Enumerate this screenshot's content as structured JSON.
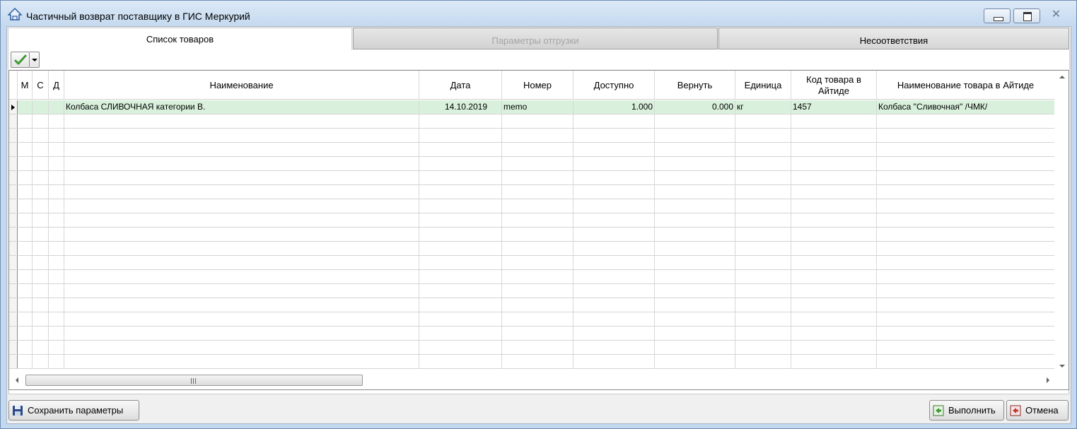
{
  "window": {
    "title": "Частичный возврат поставщику в ГИС Меркурий",
    "min_icon": "minimize-icon",
    "max_icon": "restore-icon",
    "close_symbol": "✕"
  },
  "tabs": [
    {
      "label": "Список товаров",
      "state": "active"
    },
    {
      "label": "Параметры отгрузки",
      "state": "disabled"
    },
    {
      "label": "Несоответствия",
      "state": "normal"
    }
  ],
  "toolbar": {
    "check_icon": "checkmark-icon",
    "dropdown_icon": "chevron-down-icon"
  },
  "grid": {
    "columns": [
      "М",
      "С",
      "Д",
      "Наименование",
      "Дата",
      "Номер",
      "Доступно",
      "Вернуть",
      "Единица",
      "Код товара в Айтиде",
      "Наименование товара в Айтиде"
    ],
    "rows": [
      {
        "m": "",
        "c": "",
        "d": "",
        "name": "Колбаса  СЛИВОЧНАЯ категории В.",
        "date": "14.10.2019",
        "number": "memo",
        "available": "1.000",
        "return": "0.000",
        "unit": "кг",
        "code": "1457",
        "aitida_name": "Колбаса \"Сливочная\" /ЧМК/"
      }
    ],
    "selected_row_color": "#d9f1dc"
  },
  "buttons": {
    "save": "Сохранить параметры",
    "run": "Выполнить",
    "cancel": "Отмена"
  },
  "colors": {
    "frame": "#c4d9ef",
    "accent_green": "#3c9a2e",
    "cancel_red": "#c0392b"
  }
}
